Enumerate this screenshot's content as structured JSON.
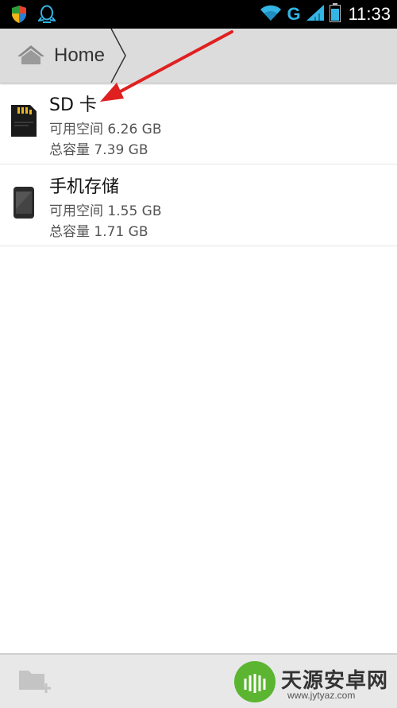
{
  "status_bar": {
    "time": "11:33",
    "network_label": "G",
    "icons_left": [
      "shield-icon",
      "qq-icon"
    ],
    "icons_right": [
      "wifi-icon",
      "signal-icon",
      "battery-icon"
    ]
  },
  "breadcrumb": {
    "home_label": "Home"
  },
  "storage": [
    {
      "title": "SD 卡",
      "free": "可用空间 6.26 GB",
      "total": "总容量 7.39 GB",
      "icon": "sd-card-icon"
    },
    {
      "title": "手机存储",
      "free": "可用空间 1.55 GB",
      "total": "总容量 1.71 GB",
      "icon": "phone-icon"
    }
  ],
  "bottom_bar": {
    "new_folder_icon": "folder-add-icon"
  },
  "watermark": {
    "title": "天源安卓网",
    "url": "www.jytyaz.com"
  },
  "colors": {
    "status_bar_bg": "#000000",
    "action_bar_bg": "#dcdcdc",
    "accent_blue": "#33b5e5",
    "annotation_red": "#e02020",
    "watermark_green": "#5cb531"
  }
}
